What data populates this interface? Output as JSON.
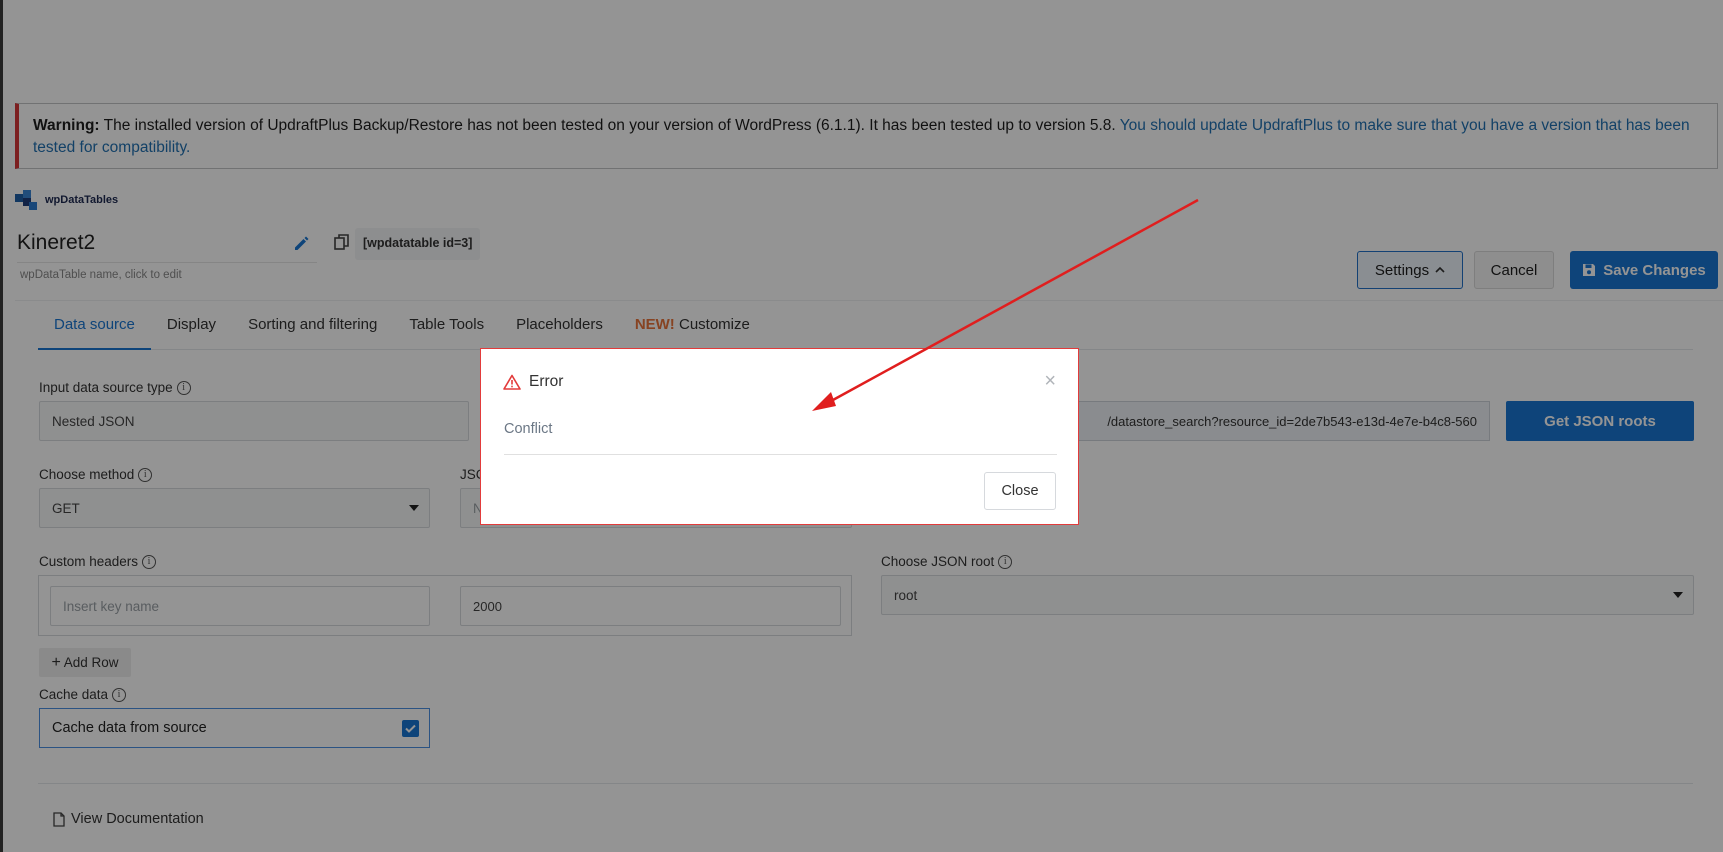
{
  "warning": {
    "prefix": "Warning:",
    "text": " The installed version of UpdraftPlus Backup/Restore has not been tested on your version of WordPress (6.1.1). It has been tested up to version 5.8. ",
    "link": "You should update UpdraftPlus to make sure that you have a version that has been tested for compatibility."
  },
  "brand": {
    "name": "wpDataTables"
  },
  "table": {
    "name": "Kineret2",
    "hint": "wpDataTable name, click to edit",
    "shortcode": "[wpdatatable id=3]"
  },
  "actions": {
    "settings": "Settings",
    "cancel": "Cancel",
    "save": "Save Changes"
  },
  "tabs": [
    {
      "label": "Data source"
    },
    {
      "label": "Display"
    },
    {
      "label": "Sorting and filtering"
    },
    {
      "label": "Table Tools"
    },
    {
      "label": "Placeholders"
    },
    {
      "badge": "NEW!",
      "label": "Customize"
    }
  ],
  "form": {
    "source_type_label": "Input data source type",
    "source_type_value": "Nested JSON",
    "method_label": "Choose method",
    "method_value": "GET",
    "json_label_partial": "JSC",
    "json_field_partial": "N",
    "url_value": "/datastore_search?resource_id=2de7b543-e13d-4e7e-b4c8-560",
    "get_roots_button": "Get JSON roots",
    "custom_headers_label": "Custom headers",
    "header_key_placeholder": "Insert key name",
    "header_value": "2000",
    "json_root_label": "Choose JSON root",
    "json_root_value": "root",
    "add_row": "Add Row",
    "cache_label": "Cache data",
    "cache_option": "Cache data from source",
    "view_docs": "View Documentation"
  },
  "modal": {
    "title": "Error",
    "message": "Conflict",
    "close_button": "Close",
    "close_x": "×"
  },
  "colors": {
    "primary": "#1976d2",
    "error": "#e23b3b",
    "warning_border": "#d63638",
    "annotation_arrow": "#e01e1e"
  }
}
